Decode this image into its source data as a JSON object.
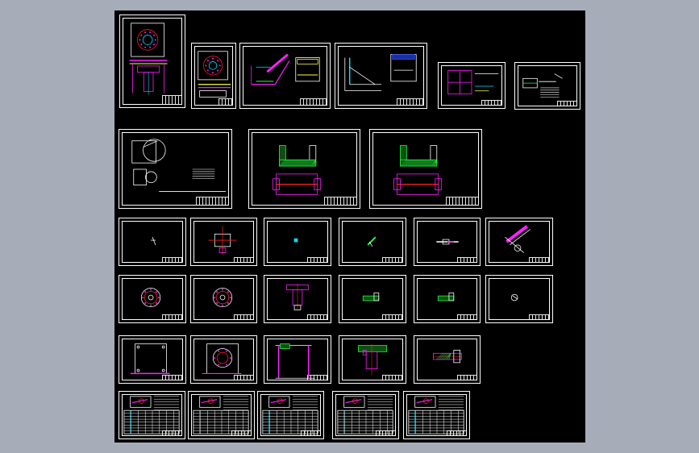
{
  "viewer": {
    "background_color": "#a7adb8",
    "model_space_color": "#000000"
  },
  "palette": {
    "line": "#ffffff",
    "red": "#ff2020",
    "cyan": "#00e0ff",
    "magenta": "#ff20ff",
    "yellow": "#ffff40",
    "green": "#20ff40",
    "blue": "#3050ff"
  },
  "sheets": [
    {
      "id": "drawing-01",
      "kind": "fixture-assembly-vertical"
    },
    {
      "id": "drawing-02",
      "kind": "fixture-plate-top-view"
    },
    {
      "id": "drawing-03",
      "kind": "fixture-isometric-pair"
    },
    {
      "id": "drawing-04",
      "kind": "bracket-isometric-pair"
    },
    {
      "id": "drawing-05",
      "kind": "block-views"
    },
    {
      "id": "drawing-06",
      "kind": "notes-sheet"
    },
    {
      "id": "drawing-07",
      "kind": "part-with-notes"
    },
    {
      "id": "drawing-08",
      "kind": "channel-section"
    },
    {
      "id": "drawing-09",
      "kind": "channel-section"
    },
    {
      "id": "drawing-10",
      "kind": "small-part"
    },
    {
      "id": "drawing-11",
      "kind": "cross-part"
    },
    {
      "id": "drawing-12",
      "kind": "tiny-part"
    },
    {
      "id": "drawing-13",
      "kind": "small-isometric"
    },
    {
      "id": "drawing-14",
      "kind": "pin"
    },
    {
      "id": "drawing-15",
      "kind": "angled-part"
    },
    {
      "id": "drawing-16",
      "kind": "round-flange"
    },
    {
      "id": "drawing-17",
      "kind": "round-flange"
    },
    {
      "id": "drawing-18",
      "kind": "t-shaft"
    },
    {
      "id": "drawing-19",
      "kind": "small-block"
    },
    {
      "id": "drawing-20",
      "kind": "small-block"
    },
    {
      "id": "drawing-21",
      "kind": "small-round"
    },
    {
      "id": "drawing-22",
      "kind": "square-plate"
    },
    {
      "id": "drawing-23",
      "kind": "plate-with-circle"
    },
    {
      "id": "drawing-24",
      "kind": "column-frame"
    },
    {
      "id": "drawing-25",
      "kind": "t-shaft-section"
    },
    {
      "id": "drawing-26",
      "kind": "long-bar"
    },
    {
      "id": "drawing-27",
      "kind": "process-card"
    },
    {
      "id": "drawing-28",
      "kind": "process-card"
    },
    {
      "id": "drawing-29",
      "kind": "process-card"
    },
    {
      "id": "drawing-30",
      "kind": "process-card"
    },
    {
      "id": "drawing-31",
      "kind": "process-card"
    }
  ]
}
